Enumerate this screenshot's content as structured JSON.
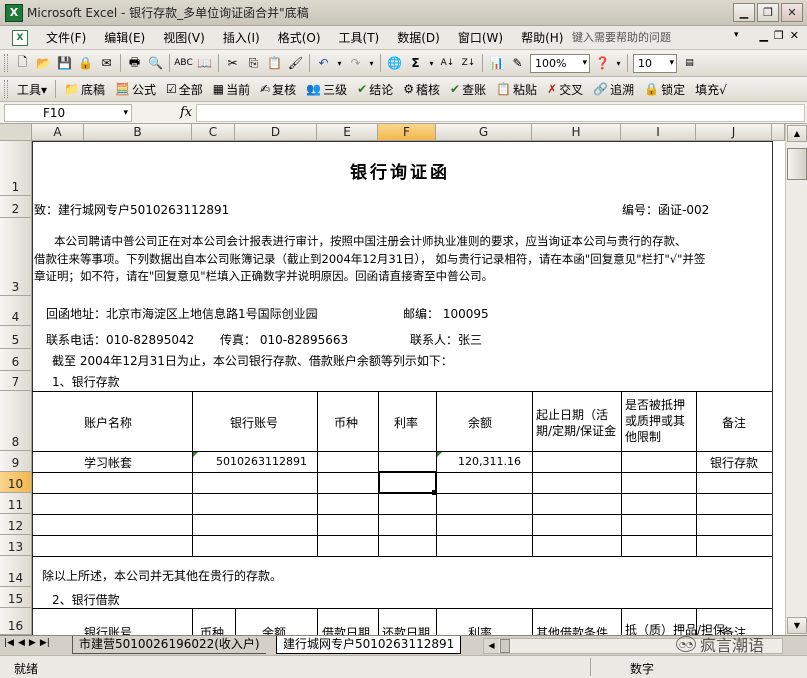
{
  "window": {
    "title": "Microsoft Excel - 银行存款_多单位询证函合并\"底稿"
  },
  "menu": {
    "items": [
      "文件(F)",
      "编辑(E)",
      "视图(V)",
      "插入(I)",
      "格式(O)",
      "工具(T)",
      "数据(D)",
      "窗口(W)",
      "帮助(H)"
    ],
    "help_placeholder": "键入需要帮助的问题"
  },
  "toolbar1": {
    "zoom": "100%",
    "font_size": "10"
  },
  "toolbar2": {
    "items": [
      "工具▾",
      "底稿",
      "公式",
      "全部",
      "当前",
      "复核",
      "三级",
      "结论",
      "稽核",
      "查账",
      "粘贴",
      "交叉",
      "追溯",
      "锁定",
      "填充√"
    ]
  },
  "formula_bar": {
    "name_box": "F10",
    "fx": "fx"
  },
  "columns": [
    "A",
    "B",
    "C",
    "D",
    "E",
    "F",
    "G",
    "H",
    "I",
    "J"
  ],
  "rows": [
    "1",
    "2",
    "3",
    "4",
    "5",
    "6",
    "7",
    "8",
    "9",
    "10",
    "11",
    "12",
    "13",
    "14",
    "15",
    "16"
  ],
  "doc": {
    "title": "银行询证函",
    "to": "致：建行城网专户5010263112891",
    "number": "编号：函证-002",
    "para_line1": "本公司聘请中普公司正在对本公司会计报表进行审计，按照中国注册会计师执业准则的要求，应当询证本公司与贵行的存款、",
    "para_line2": "借款往来等事项。下列数据出自本公司账簿记录（截止到2004年12月31日），  如与贵行记录相符，请在本函\"回复意见\"栏打\"√\"并签",
    "para_line3": "章证明；如不符，请在\"回复意见\"栏填入正确数字并说明原因。回函请直接寄至中普公司。",
    "return_address": "回函地址：北京市海淀区上地信息路1号国际创业园",
    "postcode": "邮编：  100095",
    "phone": "联系电话：010-82895042",
    "fax": "传真：  010-82895663",
    "contact": "联系人：张三",
    "cutoff": "截至 2004年12月31日为止，本公司银行存款、借款账户余额等列示如下：",
    "section1": "1、银行存款",
    "deposit_headers": [
      "账户名称",
      "银行账号",
      "币种",
      "利率",
      "余额",
      "起止日期（活期/定期/保证金",
      "是否被抵押或质押或其他限制",
      "备注"
    ],
    "deposit_row": [
      "学习帐套",
      "5010263112891",
      "",
      "",
      "120,311.16",
      "",
      "",
      "银行存款"
    ],
    "except_line": "除以上所述，本公司并无其他在贵行的存款。",
    "section2": "2、银行借款",
    "loan_headers": [
      "银行账号",
      "币种",
      "余额",
      "借款日期",
      "还款日期",
      "利率",
      "其他借款条件",
      "抵（质）押品/担保",
      "备注"
    ]
  },
  "tabs": [
    "市建营5010026196022(收入户)",
    "建行城网专户5010263112891"
  ],
  "status": {
    "left": "就绪",
    "mid": "数字"
  },
  "watermark": "疯言潮语"
}
